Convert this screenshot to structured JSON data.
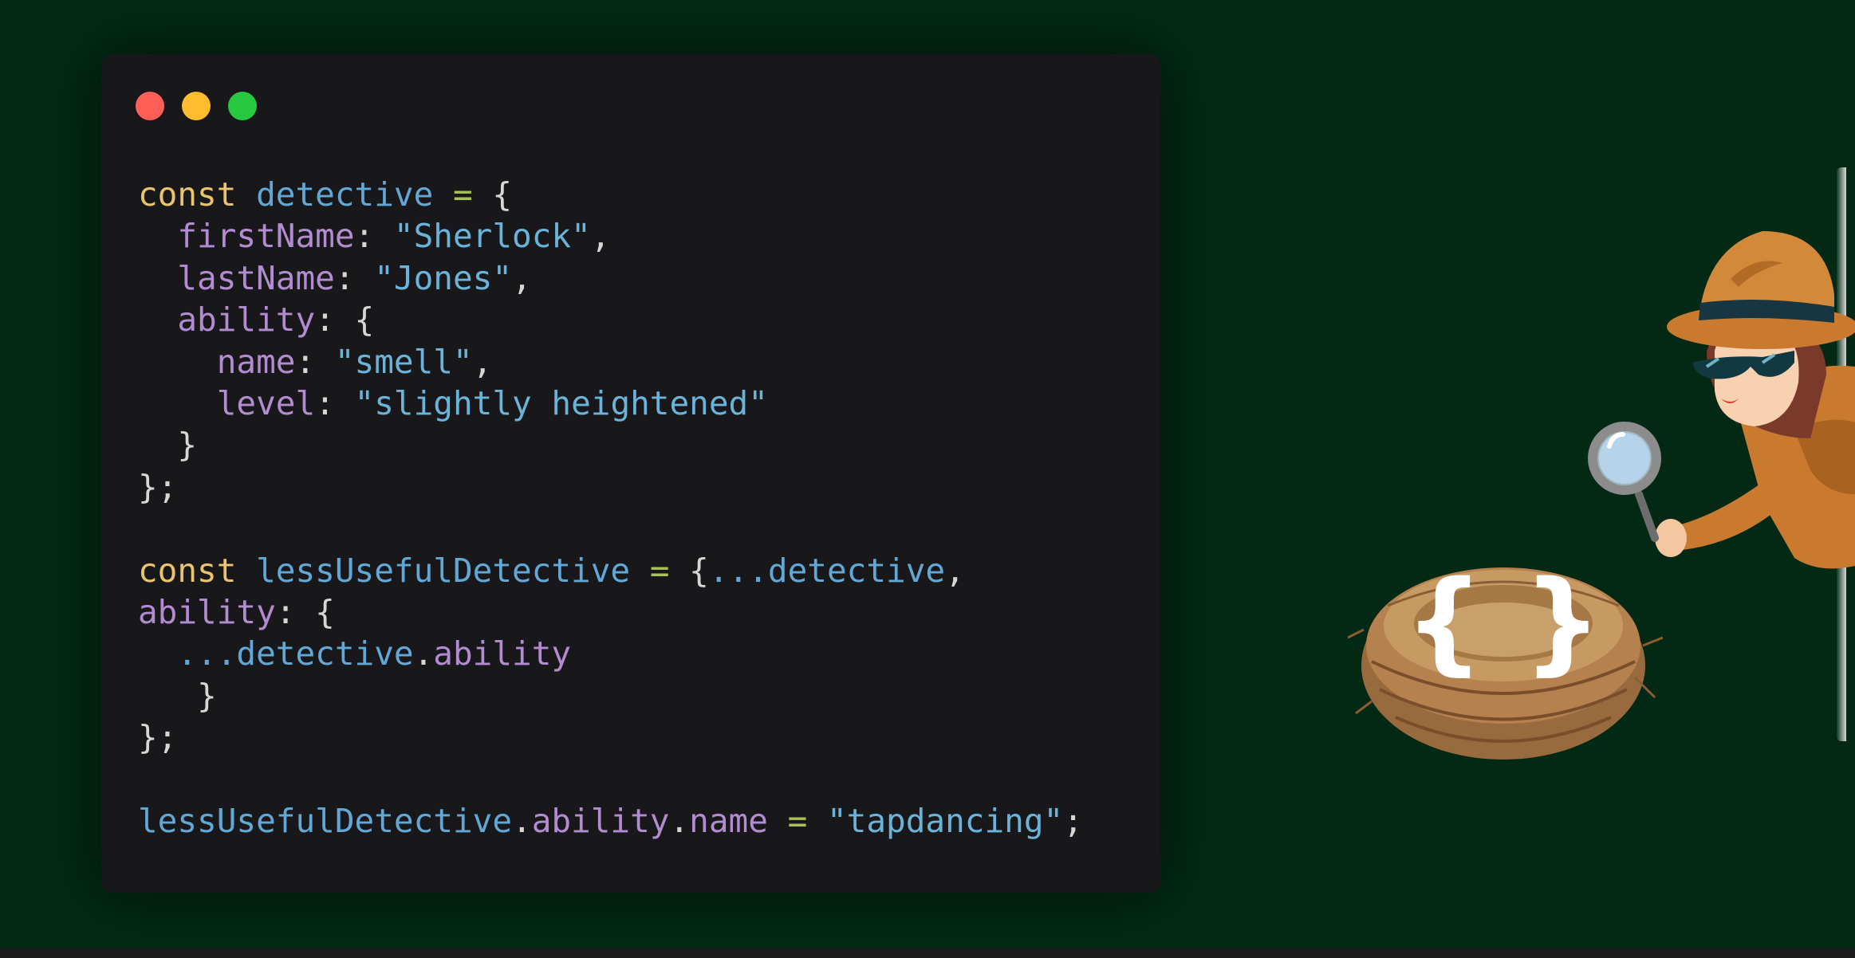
{
  "window": {
    "buttons": [
      {
        "name": "close",
        "color": "#ff5f57"
      },
      {
        "name": "minimize",
        "color": "#febc2e"
      },
      {
        "name": "maximize",
        "color": "#28c840"
      }
    ]
  },
  "code": {
    "line1": [
      "const",
      " ",
      "detective",
      " ",
      "=",
      " ",
      "{"
    ],
    "line2": [
      "  ",
      "firstName",
      ": ",
      "\"Sherlock\"",
      ","
    ],
    "line3": [
      "  ",
      "lastName",
      ": ",
      "\"Jones\"",
      ","
    ],
    "line4": [
      "  ",
      "ability",
      ": ",
      "{"
    ],
    "line5": [
      "    ",
      "name",
      ": ",
      "\"smell\"",
      ","
    ],
    "line6": [
      "    ",
      "level",
      ": ",
      "\"slightly heightened\""
    ],
    "line7": [
      "  ",
      "}"
    ],
    "line8": [
      "};"
    ],
    "line9": [
      ""
    ],
    "line10": [
      "const",
      " ",
      "lessUsefulDetective",
      " ",
      "=",
      " ",
      "{",
      "...detective",
      ","
    ],
    "line11": [
      "ability",
      ": ",
      "{"
    ],
    "line12": [
      "  ",
      "...detective",
      ".",
      "ability"
    ],
    "line13": [
      "   ",
      "}"
    ],
    "line14": [
      "};"
    ],
    "line15": [
      ""
    ],
    "line16": [
      "lessUsefulDetective",
      ".",
      "ability",
      ".",
      "name",
      " ",
      "=",
      " ",
      "\"tapdancing\"",
      ";"
    ]
  },
  "illustration": {
    "nest_label": "{ }",
    "description_icons": [
      "detective-character-icon",
      "magnifying-glass-icon",
      "bird-nest-icon"
    ]
  },
  "colors": {
    "background": "#032915",
    "editor": "#18181b",
    "keyword": "#e9c46a",
    "variable": "#62a8d6",
    "operator": "#a8c456",
    "property": "#b38bd1",
    "string": "#6ab3d9"
  }
}
